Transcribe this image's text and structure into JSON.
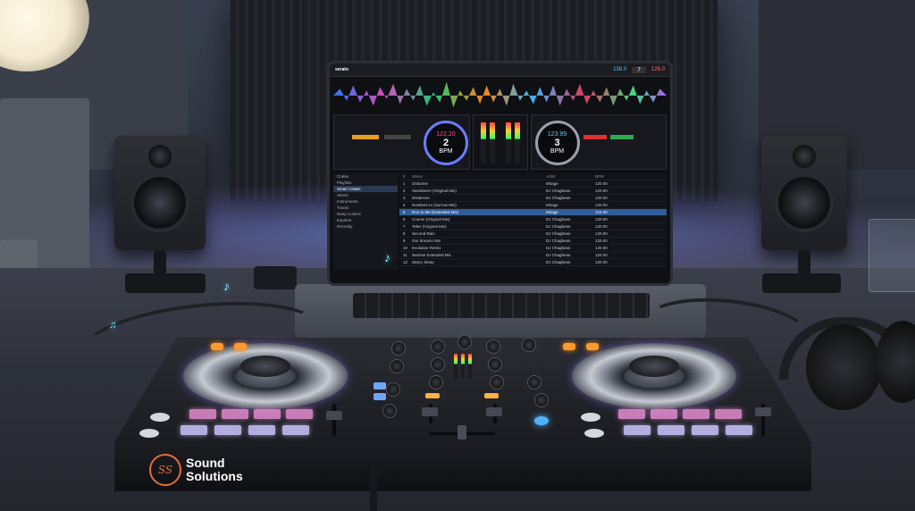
{
  "branding": {
    "logo_mark": "SS",
    "name_line1": "Sound",
    "name_line2": "Solutions"
  },
  "software": {
    "app_name": "serato",
    "deck_left": {
      "deck_number": "2",
      "bpm": "122.20",
      "bpm_unit": "BPM",
      "pitch_display": "138.0"
    },
    "deck_right": {
      "deck_number": "3",
      "bpm": "123.99",
      "bpm_unit": "BPM",
      "pitch_display": "126.0"
    },
    "top_deck_marker": "7",
    "library": {
      "columns": [
        "#",
        "Name",
        "Artist",
        "BPM"
      ],
      "rows": [
        {
          "n": "1",
          "name": "Ostionne",
          "artist": "Mirage",
          "bpm": "120.00"
        },
        {
          "n": "2",
          "name": "Sandstorm (Original Mix)",
          "artist": "DJ Chagbean",
          "bpm": "120.00"
        },
        {
          "n": "3",
          "name": "Distances",
          "artist": "DJ Chagbean",
          "bpm": "120.00"
        },
        {
          "n": "4",
          "name": "Nowhere to (Sorrow Mix)",
          "artist": "Mirage",
          "bpm": "120.00"
        },
        {
          "n": "5",
          "name": "Run to Me (Extended Mix)",
          "artist": "Mirage",
          "bpm": "124.00"
        },
        {
          "n": "6",
          "name": "Course (Original Mix)",
          "artist": "DJ Chagbean",
          "bpm": "120.00"
        },
        {
          "n": "7",
          "name": "Tales (Original Mix)",
          "artist": "DJ Chagbean",
          "bpm": "120.00"
        },
        {
          "n": "8",
          "name": "Second Rain",
          "artist": "DJ Chagbean",
          "bpm": "120.00"
        },
        {
          "n": "9",
          "name": "Our dreams Mix",
          "artist": "DJ Chagbean",
          "bpm": "120.00"
        },
        {
          "n": "10",
          "name": "Evolution Remix",
          "artist": "DJ Chagbean",
          "bpm": "120.00"
        },
        {
          "n": "11",
          "name": "Sunrise Extended Mix",
          "artist": "DJ Chagbean",
          "bpm": "120.00"
        },
        {
          "n": "12",
          "name": "Starry Sleep",
          "artist": "DJ Chagbean",
          "bpm": "120.00"
        }
      ],
      "highlighted_index": 4,
      "sidebar": [
        "Crates",
        "Playlists",
        "Smart Crates",
        "Stems",
        "Instruments",
        "Tracks",
        "Deep Control",
        "Explorer",
        "Recently"
      ],
      "sidebar_selected": 2
    }
  },
  "colors": {
    "accent_orange": "#e26d3c",
    "ambient_glow": "#7896ff",
    "selected_row": "#2e5d9a"
  },
  "icons": [
    "music-note-icon",
    "headphones-icon",
    "speaker-icon",
    "jog-wheel-icon"
  ]
}
